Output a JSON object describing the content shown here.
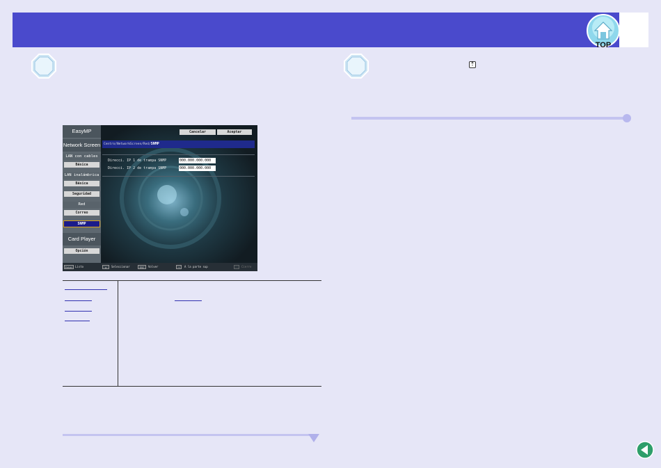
{
  "header": {
    "logo_text": "TOP",
    "color": "#4a4acc"
  },
  "inline_key_glyph": "⇡",
  "screenshot": {
    "app_title": "EasyMP",
    "section_network": "Network Screen",
    "section_lan_wired": "LAN con cables",
    "item_basica_1": "Básica",
    "section_lan_wireless": "LAN inalámbrica",
    "item_basica_2": "Básica",
    "item_seguridad": "Seguridad",
    "item_red": "Red",
    "item_correo": "Correo",
    "item_snmp": "SNMP",
    "section_card": "Card Player",
    "item_opcion": "Opción",
    "btn_cancel": "Cancelar",
    "btn_accept": "Aceptar",
    "breadcrumb": "Centro/NetworkScreen/Red/",
    "breadcrumb_current": "SNMP",
    "field1_label": "Direcci. IP 1 de trampa SNMP",
    "field1_value": "000.000.000.000",
    "field2_label": "Direcci. IP 2 de trampa SNMP",
    "field2_value": "000.000.000.000",
    "footer": {
      "k1": "Enter",
      "t1": "Listo",
      "k2": "✥",
      "t2": "Seleccionar",
      "k3": "ESC",
      "t3": "Volver",
      "k4": "⇡",
      "t4": "A la parte sup",
      "k5": "",
      "t5": "Cierre"
    }
  }
}
